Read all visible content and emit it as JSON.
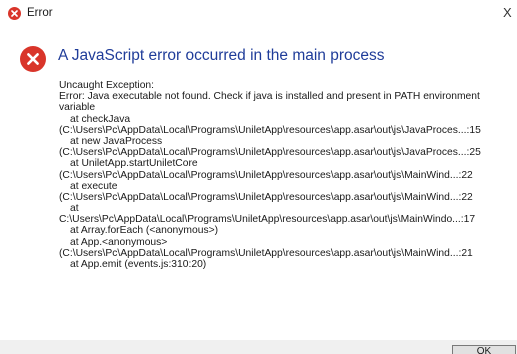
{
  "window": {
    "title": "Error",
    "close_glyph": "X"
  },
  "colors": {
    "error_red": "#d9352a",
    "heading_blue": "#1f3c99"
  },
  "icons": {
    "title": "error-icon",
    "main": "error-icon"
  },
  "dialog": {
    "heading": "A JavaScript error occurred in the main process",
    "lines": [
      "Uncaught Exception:",
      "Error: Java executable not found. Check if java is installed and present in PATH environment variable",
      "at checkJava",
      "(C:\\Users\\Pc\\AppData\\Local\\Programs\\UniletApp\\resources\\app.asar\\out\\js\\JavaProces...:15",
      "at new JavaProcess",
      "(C:\\Users\\Pc\\AppData\\Local\\Programs\\UniletApp\\resources\\app.asar\\out\\js\\JavaProces...:25",
      "at UniletApp.startUniletCore",
      "(C:\\Users\\Pc\\AppData\\Local\\Programs\\UniletApp\\resources\\app.asar\\out\\js\\MainWind...:22",
      "at execute",
      "(C:\\Users\\Pc\\AppData\\Local\\Programs\\UniletApp\\resources\\app.asar\\out\\js\\MainWind...:22",
      "at",
      "C:\\Users\\Pc\\AppData\\Local\\Programs\\UniletApp\\resources\\app.asar\\out\\js\\MainWindo...:17",
      "at Array.forEach (<anonymous>)",
      "at App.<anonymous>",
      "(C:\\Users\\Pc\\AppData\\Local\\Programs\\UniletApp\\resources\\app.asar\\out\\js\\MainWind...:21",
      "at App.emit (events.js:310:20)"
    ],
    "ok_label": "OK"
  }
}
